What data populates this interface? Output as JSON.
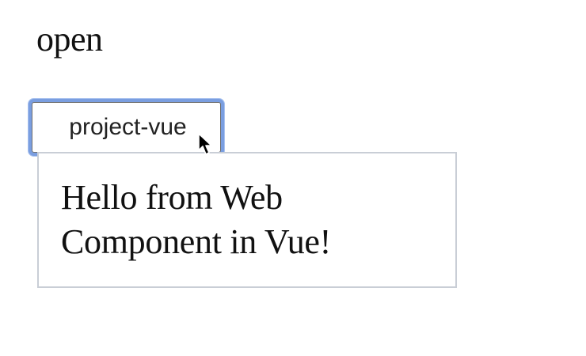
{
  "state": {
    "label": "open"
  },
  "toggle": {
    "label": "project-vue"
  },
  "panel": {
    "message": "Hello from Web Component in Vue!"
  },
  "cursor": {
    "icon": "arrow-pointer-icon"
  },
  "colors": {
    "focus_ring": "#7a9ee0",
    "panel_border": "#c9ced6",
    "text": "#111111"
  }
}
